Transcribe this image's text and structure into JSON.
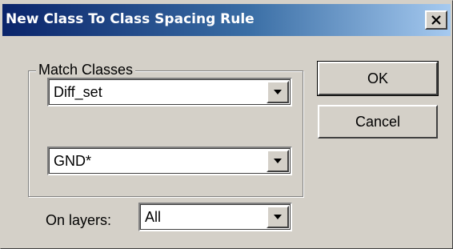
{
  "window": {
    "title": "New Class To Class Spacing Rule"
  },
  "match_classes": {
    "group_label": "Match Classes",
    "class_1": {
      "value": "Diff_set"
    },
    "class_2": {
      "value": "GND*"
    }
  },
  "buttons": {
    "ok_label": "OK",
    "cancel_label": "Cancel"
  },
  "layers": {
    "label": "On layers:",
    "value": "All"
  },
  "colors": {
    "face": "#d4d0c8",
    "title_start": "#0a246a",
    "title_end": "#a6caf0"
  },
  "icons": {
    "close": "close-icon",
    "dropdown": "chevron-down-icon"
  }
}
